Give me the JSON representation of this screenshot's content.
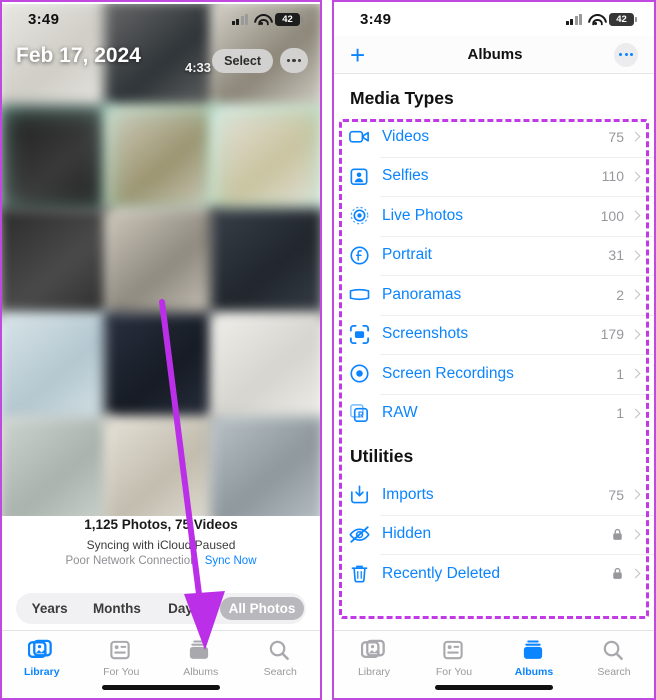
{
  "left_panel": {
    "status": {
      "time": "3:49",
      "battery": "42",
      "signal_icon": "cellular-signal-icon",
      "wifi_icon": "wifi-icon",
      "battery_icon": "battery-icon"
    },
    "date_label": "Feb 17, 2024",
    "video_duration": "4:33",
    "select_button": "Select",
    "more_button_icon": "ellipsis-icon",
    "library_count": "1,125 Photos, 75 Videos",
    "sync_status": "Syncing with iCloud Paused",
    "network_status": "Poor Network Connection",
    "sync_now": "Sync Now",
    "segments": [
      {
        "label": "Years",
        "active": false
      },
      {
        "label": "Months",
        "active": false
      },
      {
        "label": "Days",
        "active": false
      },
      {
        "label": "All Photos",
        "active": true
      }
    ],
    "tabs": [
      {
        "label": "Library",
        "icon": "photos-library-icon",
        "active": true
      },
      {
        "label": "For You",
        "icon": "for-you-icon",
        "active": false
      },
      {
        "label": "Albums",
        "icon": "albums-icon",
        "active": false
      },
      {
        "label": "Search",
        "icon": "search-icon",
        "active": false
      }
    ]
  },
  "right_panel": {
    "status": {
      "time": "3:49",
      "battery": "42",
      "signal_icon": "cellular-signal-icon",
      "wifi_icon": "wifi-icon",
      "battery_icon": "battery-icon"
    },
    "nav": {
      "add_icon": "plus-icon",
      "title": "Albums",
      "more_icon": "ellipsis-icon"
    },
    "sections": [
      {
        "title": "Media Types",
        "rows": [
          {
            "label": "Videos",
            "count": "75",
            "icon": "video-camera-icon"
          },
          {
            "label": "Selfies",
            "count": "110",
            "icon": "selfie-person-icon"
          },
          {
            "label": "Live Photos",
            "count": "100",
            "icon": "live-photo-icon"
          },
          {
            "label": "Portrait",
            "count": "31",
            "icon": "portrait-aperture-icon"
          },
          {
            "label": "Panoramas",
            "count": "2",
            "icon": "panorama-icon"
          },
          {
            "label": "Screenshots",
            "count": "179",
            "icon": "screenshot-icon"
          },
          {
            "label": "Screen Recordings",
            "count": "1",
            "icon": "screen-recording-icon"
          },
          {
            "label": "RAW",
            "count": "1",
            "icon": "raw-badge-icon"
          }
        ]
      },
      {
        "title": "Utilities",
        "rows": [
          {
            "label": "Imports",
            "count": "75",
            "icon": "import-download-icon"
          },
          {
            "label": "Hidden",
            "count": "",
            "icon": "eye-slash-icon",
            "locked": true,
            "lock_icon": "lock-icon"
          },
          {
            "label": "Recently Deleted",
            "count": "",
            "icon": "trash-icon",
            "locked": true,
            "lock_icon": "lock-icon"
          }
        ]
      }
    ],
    "tabs": [
      {
        "label": "Library",
        "icon": "photos-library-icon",
        "active": false
      },
      {
        "label": "For You",
        "icon": "for-you-icon",
        "active": false
      },
      {
        "label": "Albums",
        "icon": "albums-icon",
        "active": true
      },
      {
        "label": "Search",
        "icon": "search-icon",
        "active": false
      }
    ]
  },
  "annotations": {
    "highlight_color": "#c23ae8",
    "arrow_color": "#bb2fe8",
    "arrow_target": "albums-tab"
  }
}
